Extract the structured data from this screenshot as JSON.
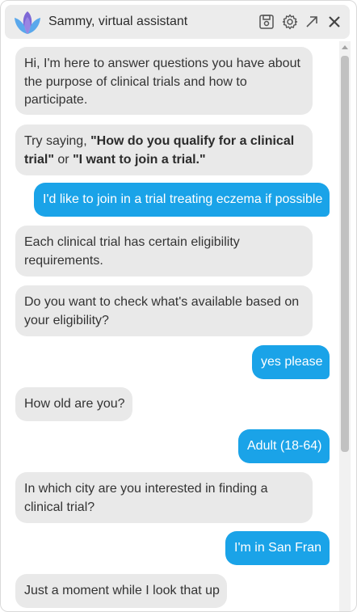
{
  "header": {
    "title": "Sammy, virtual assistant",
    "icons": [
      "logo-lotus-icon",
      "save-icon",
      "settings-gear-icon",
      "expand-arrow-icon",
      "close-icon"
    ]
  },
  "messages": [
    {
      "from": "bot",
      "lines": [
        "Hi, I'm here to answer questions you have about",
        "the purpose of clinical trials and how to",
        "participate."
      ]
    },
    {
      "from": "bot",
      "line1_prefix": "Try saying, ",
      "line1_bold": "\"How do you qualify for a clinical",
      "line2_bold_a": "trial\"",
      "line2_mid": " or ",
      "line2_bold_b": "\"I want to join a trial.\""
    },
    {
      "from": "user",
      "text": "I'd like to join in a trial treating eczema if possible"
    },
    {
      "from": "bot",
      "lines": [
        "Each clinical trial has certain eligibility",
        "requirements."
      ]
    },
    {
      "from": "bot",
      "lines": [
        "Do you want to check what's available based on",
        "your eligibility?"
      ]
    },
    {
      "from": "user",
      "text": "yes please"
    },
    {
      "from": "bot",
      "lines": [
        "How old are you?"
      ]
    },
    {
      "from": "user",
      "text": "Adult (18-64)"
    },
    {
      "from": "bot",
      "lines": [
        "In which city are you interested in finding a",
        "clinical trial?"
      ]
    },
    {
      "from": "user",
      "text": "I'm in San Fran"
    },
    {
      "from": "bot",
      "lines": [
        "Just a moment while I look that up"
      ]
    }
  ],
  "colors": {
    "user_bubble": "#1aa3e8",
    "bot_bubble": "#e9e9e9",
    "header_bg": "#ececec",
    "logo_purple": "#7e68d6",
    "logo_blue": "#5aa8ec"
  }
}
